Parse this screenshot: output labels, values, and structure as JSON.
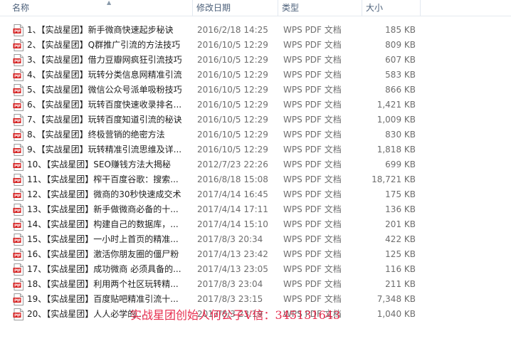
{
  "columns": {
    "name": "名称",
    "date": "修改日期",
    "type": "类型",
    "size": "大小"
  },
  "icon": "pdf-file-icon",
  "colors": {
    "header_text": "#4c607a",
    "pdf_red": "#d51d1d",
    "watermark": "#e4173b"
  },
  "files": [
    {
      "name": "1、【实战星团】新手微商快速起步秘诀",
      "date": "2016/2/18 14:25",
      "type": "WPS PDF 文档",
      "size": "185 KB"
    },
    {
      "name": "2、【实战星团】Q群推广引流的方法技巧",
      "date": "2016/10/5 12:29",
      "type": "WPS PDF 文档",
      "size": "809 KB"
    },
    {
      "name": "3、【实战星团】借力豆瓣网疯狂引流技巧",
      "date": "2016/10/5 12:29",
      "type": "WPS PDF 文档",
      "size": "607 KB"
    },
    {
      "name": "4、【实战星团】玩转分类信息网精准引流",
      "date": "2016/10/5 12:29",
      "type": "WPS PDF 文档",
      "size": "583 KB"
    },
    {
      "name": "5、【实战星团】微信公众号派单吸粉技巧",
      "date": "2016/10/5 12:29",
      "type": "WPS PDF 文档",
      "size": "866 KB"
    },
    {
      "name": "6、【实战星团】玩转百度快速收录排名...",
      "date": "2016/10/5 12:29",
      "type": "WPS PDF 文档",
      "size": "1,421 KB"
    },
    {
      "name": "7、【实战星团】玩转百度知道引流的秘诀",
      "date": "2016/10/5 12:29",
      "type": "WPS PDF 文档",
      "size": "1,009 KB"
    },
    {
      "name": "8、【实战星团】终极营销的绝密方法",
      "date": "2016/10/5 12:29",
      "type": "WPS PDF 文档",
      "size": "830 KB"
    },
    {
      "name": "9、【实战星团】玩转精准引流思维及详...",
      "date": "2016/10/5 12:29",
      "type": "WPS PDF 文档",
      "size": "1,818 KB"
    },
    {
      "name": "10、【实战星团】SEO赚钱方法大揭秘",
      "date": "2012/7/23 22:26",
      "type": "WPS PDF 文档",
      "size": "699 KB"
    },
    {
      "name": "11、【实战星团】榨干百度谷歌：搜索...",
      "date": "2016/8/18 15:08",
      "type": "WPS PDF 文档",
      "size": "18,721 KB"
    },
    {
      "name": "12、【实战星团】微商的30秒快速成交术",
      "date": "2017/4/14 16:45",
      "type": "WPS PDF 文档",
      "size": "175 KB"
    },
    {
      "name": "13、【实战星团】新手做微商必备的十...",
      "date": "2017/4/14 17:11",
      "type": "WPS PDF 文档",
      "size": "136 KB"
    },
    {
      "name": "14、【实战星团】构建自己的数据库，...",
      "date": "2017/4/14 15:10",
      "type": "WPS PDF 文档",
      "size": "201 KB"
    },
    {
      "name": "15、【实战星团】一小时上首页的精准...",
      "date": "2017/8/3 20:34",
      "type": "WPS PDF 文档",
      "size": "422 KB"
    },
    {
      "name": "16、【实战星团】激活你朋友圈的僵尸粉",
      "date": "2017/4/13 23:42",
      "type": "WPS PDF 文档",
      "size": "125 KB"
    },
    {
      "name": "17、【实战星团】成功微商 必须具备的...",
      "date": "2017/4/13 23:05",
      "type": "WPS PDF 文档",
      "size": "116 KB"
    },
    {
      "name": "18、【实战星团】利用两个社区玩转精...",
      "date": "2017/8/3 23:04",
      "type": "WPS PDF 文档",
      "size": "211 KB"
    },
    {
      "name": "19、【实战星团】百度贴吧精准引流十...",
      "date": "2017/8/3 23:15",
      "type": "WPS PDF 文档",
      "size": "7,348 KB"
    },
    {
      "name": "20、【实战星团】人人必学的...",
      "date": "2017/8/3 23:19",
      "type": "WPS PDF 文档",
      "size": "1,040 KB"
    }
  ],
  "watermark": "实战星团创始人何公子V信：345131643"
}
